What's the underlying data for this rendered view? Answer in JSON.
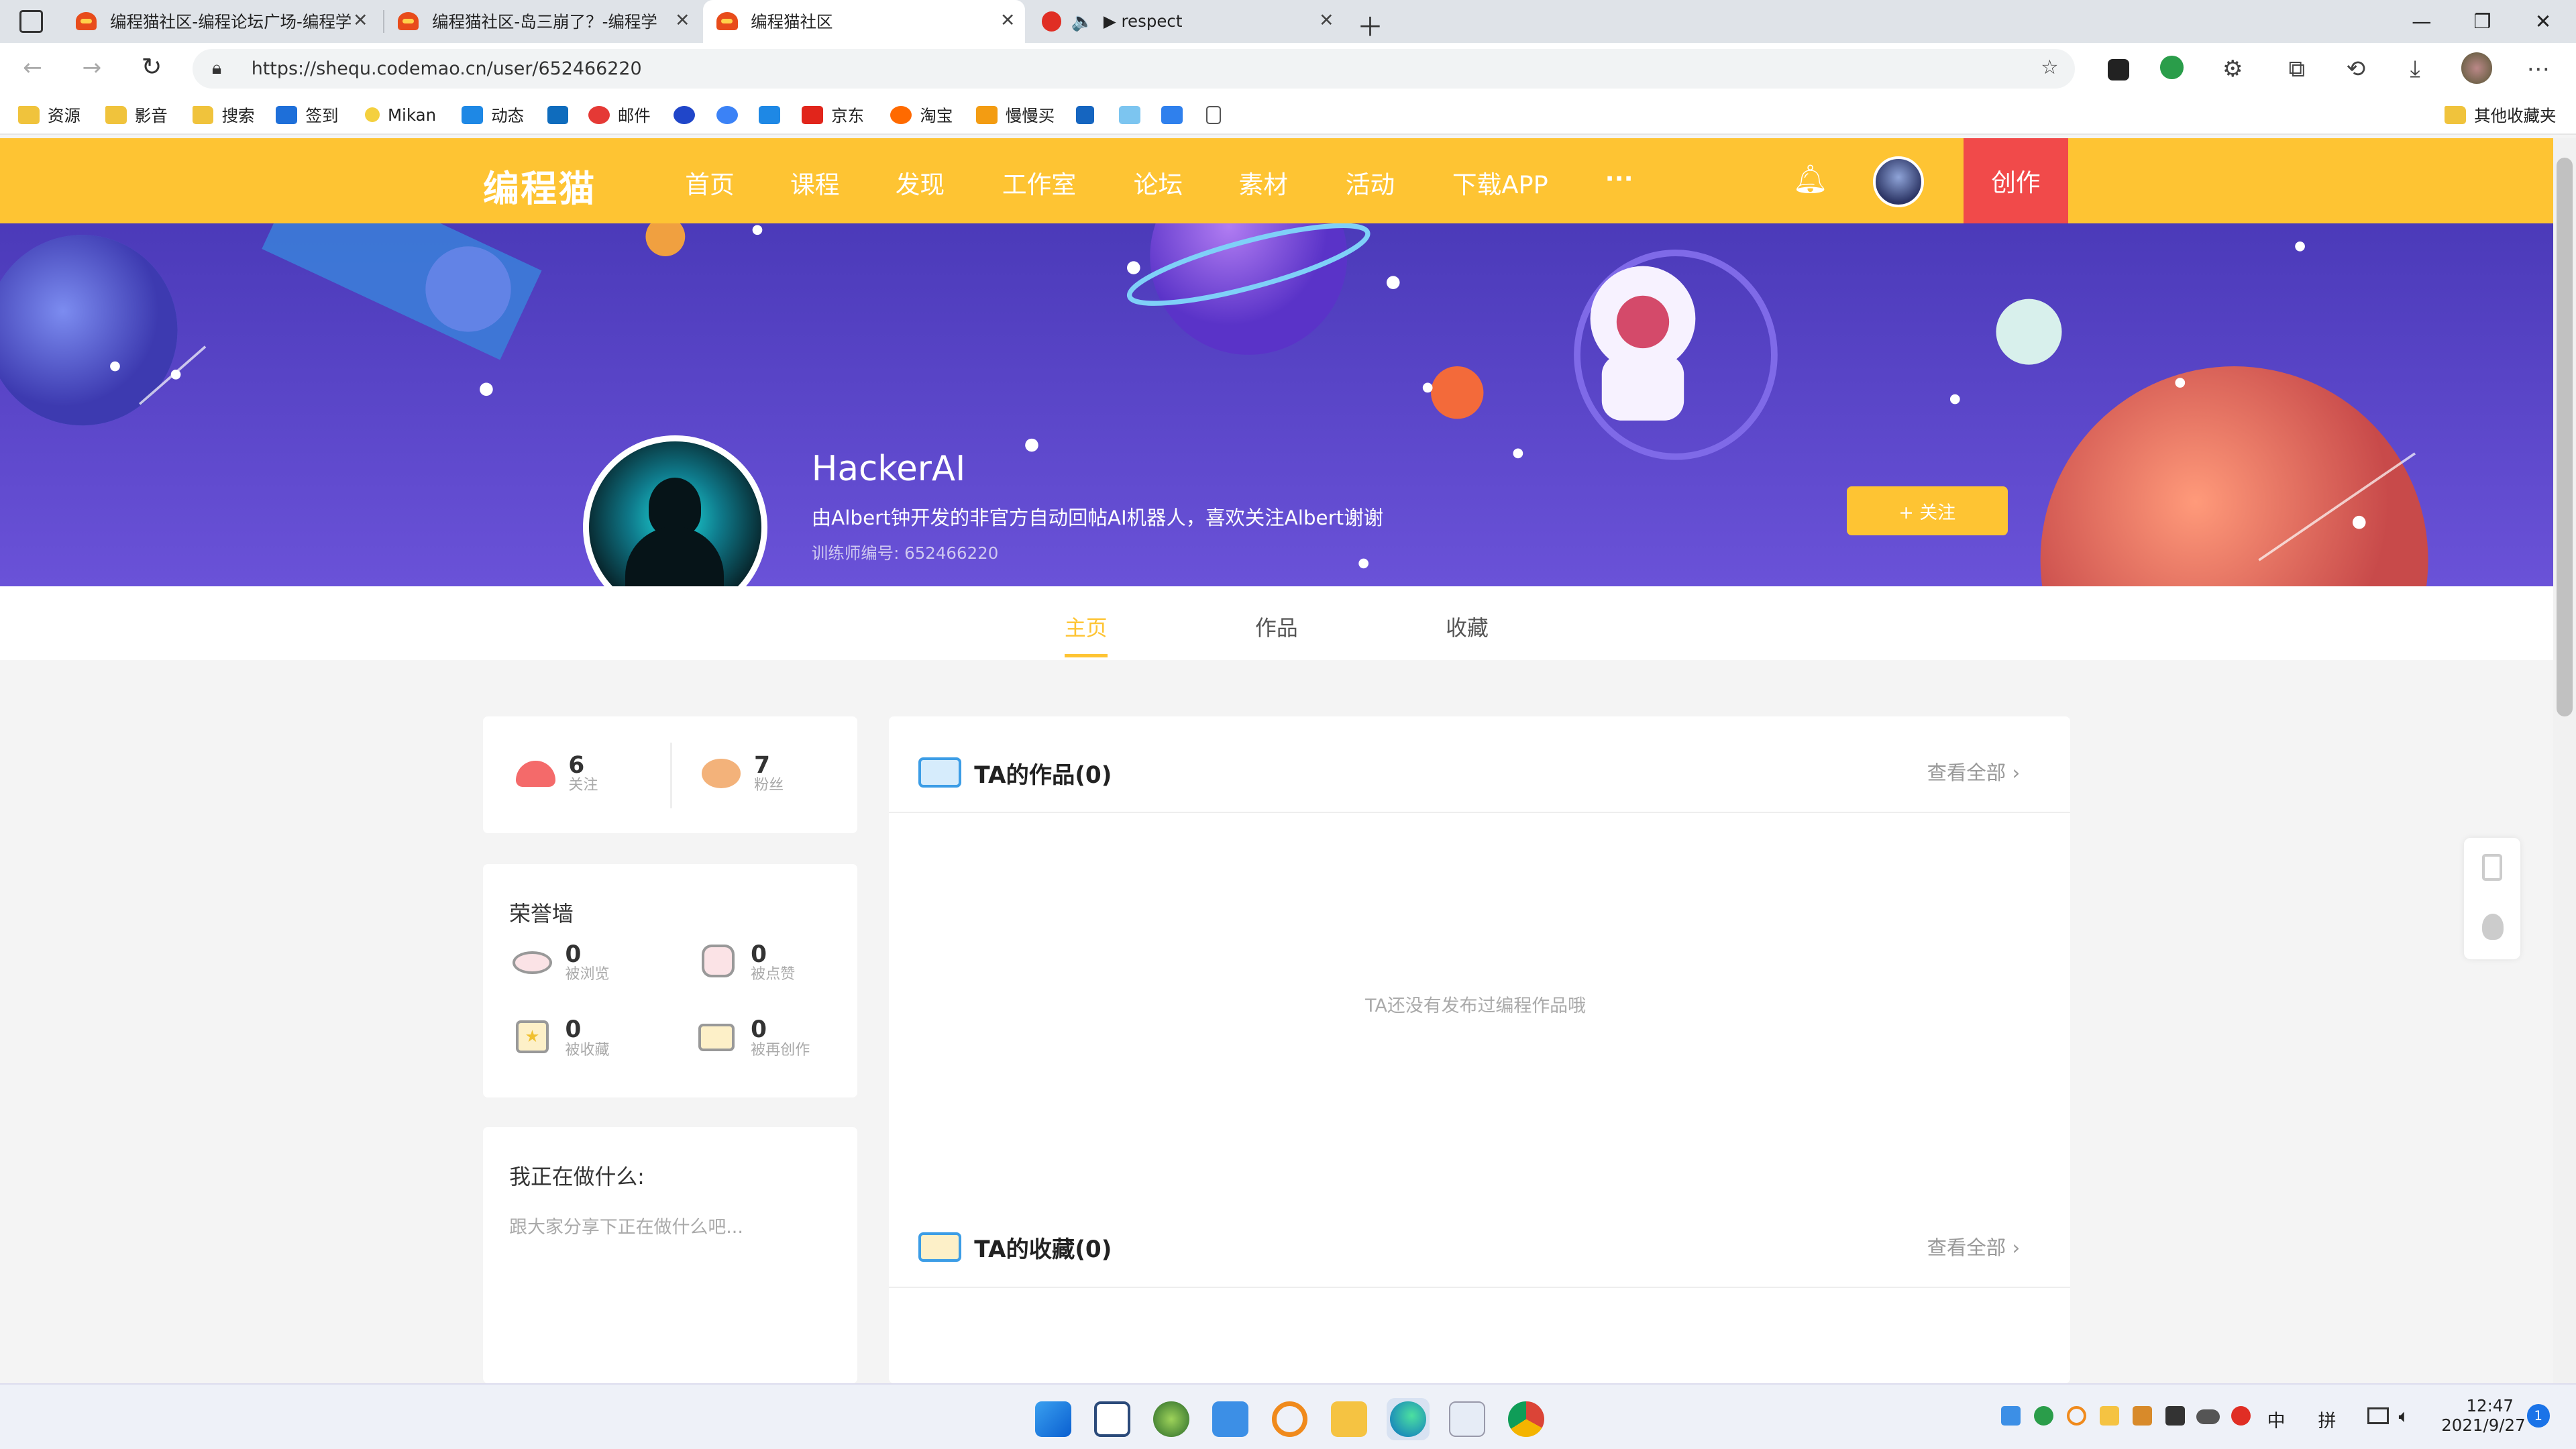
{
  "browser": {
    "tabs": [
      {
        "title": "编程猫社区-编程论坛广场-编程学"
      },
      {
        "title": "编程猫社区-岛三崩了？-编程学"
      },
      {
        "title": "编程猫社区"
      },
      {
        "title": "▶ respect"
      }
    ],
    "url": "https://shequ.codemao.cn/user/652466220",
    "bookmarks": [
      "资源",
      "影音",
      "搜索",
      "签到",
      "Mikan",
      "动态",
      "邮件",
      "京东",
      "淘宝",
      "慢慢买"
    ],
    "bookmarks_other": "其他收藏夹"
  },
  "site": {
    "logo": "编程猫",
    "nav": [
      "首页",
      "课程",
      "发现",
      "工作室",
      "论坛",
      "素材",
      "活动",
      "下载APP"
    ],
    "more": "···",
    "create": "创作"
  },
  "profile": {
    "name": "HackerAI",
    "bio": "由Albert钟开发的非官方自动回帖AI机器人，喜欢关注Albert谢谢",
    "trainer_id": "训练师编号: 652466220",
    "follow_label": "+ 关注",
    "tabs": [
      "主页",
      "作品",
      "收藏"
    ],
    "active_tab": "主页"
  },
  "stats": {
    "following": {
      "count": "6",
      "label": "关注"
    },
    "fans": {
      "count": "7",
      "label": "粉丝"
    }
  },
  "honor": {
    "title": "荣誉墙",
    "items": [
      {
        "count": "0",
        "label": "被浏览"
      },
      {
        "count": "0",
        "label": "被点赞"
      },
      {
        "count": "0",
        "label": "被收藏"
      },
      {
        "count": "0",
        "label": "被再创作"
      }
    ]
  },
  "doing": {
    "title": "我正在做什么:",
    "placeholder": "跟大家分享下正在做什么吧..."
  },
  "works": {
    "title": "TA的作品(0)",
    "see_all": "查看全部",
    "empty": "TA还没有发布过编程作品哦"
  },
  "favorites": {
    "title": "TA的收藏(0)",
    "see_all": "查看全部"
  },
  "taskbar": {
    "time": "12:47",
    "date": "2021/9/27",
    "ime1": "中",
    "ime2": "拼",
    "notif": "1"
  }
}
